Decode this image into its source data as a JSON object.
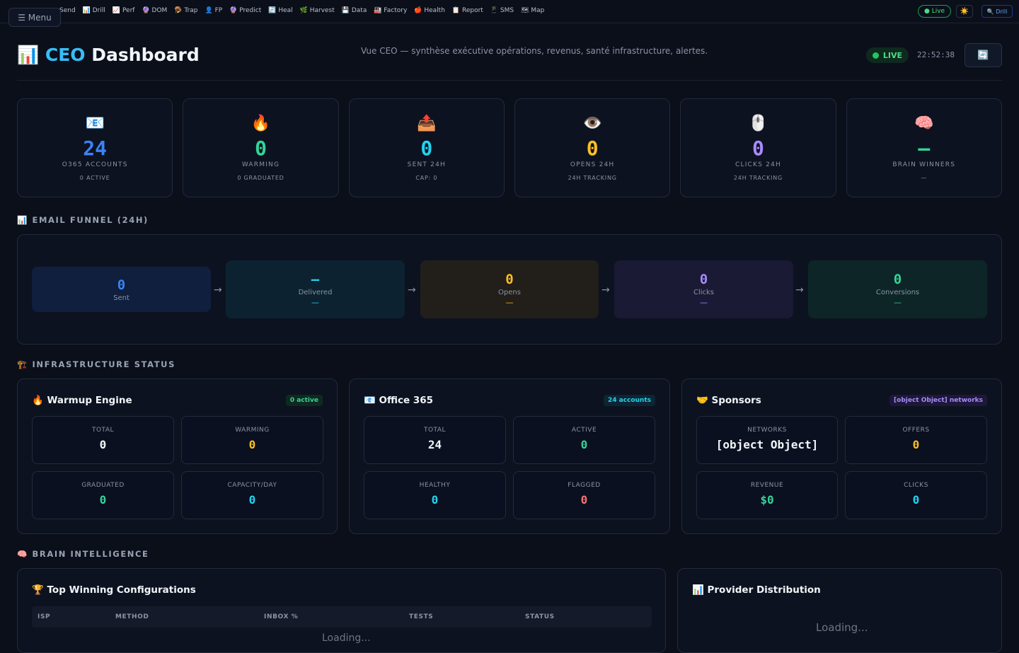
{
  "nav": {
    "menu_label": "☰ Menu",
    "items": [
      "Send",
      "📊 Drill",
      "📈 Perf",
      "🔮 DOM",
      "🪤 Trap",
      "👤 FP",
      "🔮 Predict",
      "🔄 Heal",
      "🌿 Harvest",
      "💾 Data",
      "🏭 Factory",
      "🍎 Health",
      "📋 Report",
      "📱 SMS",
      "🗺 Map"
    ],
    "live_pill": "● Live",
    "theme_icon": "☀️",
    "drill_btn": "🔍 Drill"
  },
  "header": {
    "title_icon": "📊",
    "title_accent": "CEO",
    "title_rest": "Dashboard",
    "subtitle": "Vue CEO — synthèse exécutive opérations, revenus, santé infrastructure, alertes.",
    "live": "LIVE",
    "clock": "22:52:38",
    "refresh_icon": "🔄"
  },
  "kpis": [
    {
      "icon": "📧",
      "value": "24",
      "label": "O365 ACCOUNTS",
      "sub": "0 ACTIVE",
      "color": "#3b82f6"
    },
    {
      "icon": "🔥",
      "value": "0",
      "label": "WARMING",
      "sub": "0 GRADUATED",
      "color": "#34d399"
    },
    {
      "icon": "📤",
      "value": "0",
      "label": "SENT 24H",
      "sub": "CAP: 0",
      "color": "#22d3ee"
    },
    {
      "icon": "👁️",
      "value": "0",
      "label": "OPENS 24H",
      "sub": "24H TRACKING",
      "color": "#fbbf24"
    },
    {
      "icon": "🖱️",
      "value": "0",
      "label": "CLICKS 24H",
      "sub": "24H TRACKING",
      "color": "#a78bfa"
    },
    {
      "icon": "🧠",
      "value": "—",
      "label": "BRAIN WINNERS",
      "sub": "—",
      "color": "#34d399"
    }
  ],
  "funnel": {
    "heading": "📊 EMAIL FUNNEL (24H)",
    "stages": [
      {
        "value": "0",
        "label": "Sent",
        "pct": "",
        "color": "#3b82f6",
        "bg": "#0f1f3d"
      },
      {
        "value": "—",
        "label": "Delivered",
        "pct": "—",
        "color": "#22d3ee",
        "bg": "#0c2230"
      },
      {
        "value": "0",
        "label": "Opens",
        "pct": "—",
        "color": "#fbbf24",
        "bg": "#221e1a"
      },
      {
        "value": "0",
        "label": "Clicks",
        "pct": "—",
        "color": "#a78bfa",
        "bg": "#1a1a35"
      },
      {
        "value": "0",
        "label": "Conversions",
        "pct": "—",
        "color": "#34d399",
        "bg": "#0d2526"
      }
    ],
    "arrow": "→"
  },
  "infra": {
    "heading": "🏗️ INFRASTRUCTURE STATUS",
    "cards": [
      {
        "title": "🔥 Warmup Engine",
        "badge": "0 active",
        "badge_color": "#34d399",
        "badge_bg": "#0e2a1f",
        "stats": [
          {
            "label": "TOTAL",
            "value": "0",
            "color": "#f1f5f9"
          },
          {
            "label": "WARMING",
            "value": "0",
            "color": "#fbbf24"
          },
          {
            "label": "GRADUATED",
            "value": "0",
            "color": "#34d399"
          },
          {
            "label": "CAPACITY/DAY",
            "value": "0",
            "color": "#22d3ee"
          }
        ]
      },
      {
        "title": "📧 Office 365",
        "badge": "24 accounts",
        "badge_color": "#22d3ee",
        "badge_bg": "#0c2533",
        "stats": [
          {
            "label": "TOTAL",
            "value": "24",
            "color": "#f1f5f9"
          },
          {
            "label": "ACTIVE",
            "value": "0",
            "color": "#34d399"
          },
          {
            "label": "HEALTHY",
            "value": "0",
            "color": "#22d3ee"
          },
          {
            "label": "FLAGGED",
            "value": "0",
            "color": "#f87171"
          }
        ]
      },
      {
        "title": "🤝 Sponsors",
        "badge": "[object Object] networks",
        "badge_color": "#a78bfa",
        "badge_bg": "#1d1838",
        "stats": [
          {
            "label": "NETWORKS",
            "value": "[object Object]",
            "color": "#f1f5f9"
          },
          {
            "label": "OFFERS",
            "value": "0",
            "color": "#fbbf24"
          },
          {
            "label": "REVENUE",
            "value": "$0",
            "color": "#34d399"
          },
          {
            "label": "CLICKS",
            "value": "0",
            "color": "#22d3ee"
          }
        ]
      }
    ]
  },
  "brain": {
    "heading": "🧠 BRAIN INTELLIGENCE",
    "top_title": "🏆 Top Winning Configurations",
    "columns": [
      "ISP",
      "METHOD",
      "INBOX %",
      "TESTS",
      "STATUS"
    ],
    "table_loading": "Loading...",
    "provider_title": "📊 Provider Distribution",
    "provider_loading": "Loading..."
  }
}
